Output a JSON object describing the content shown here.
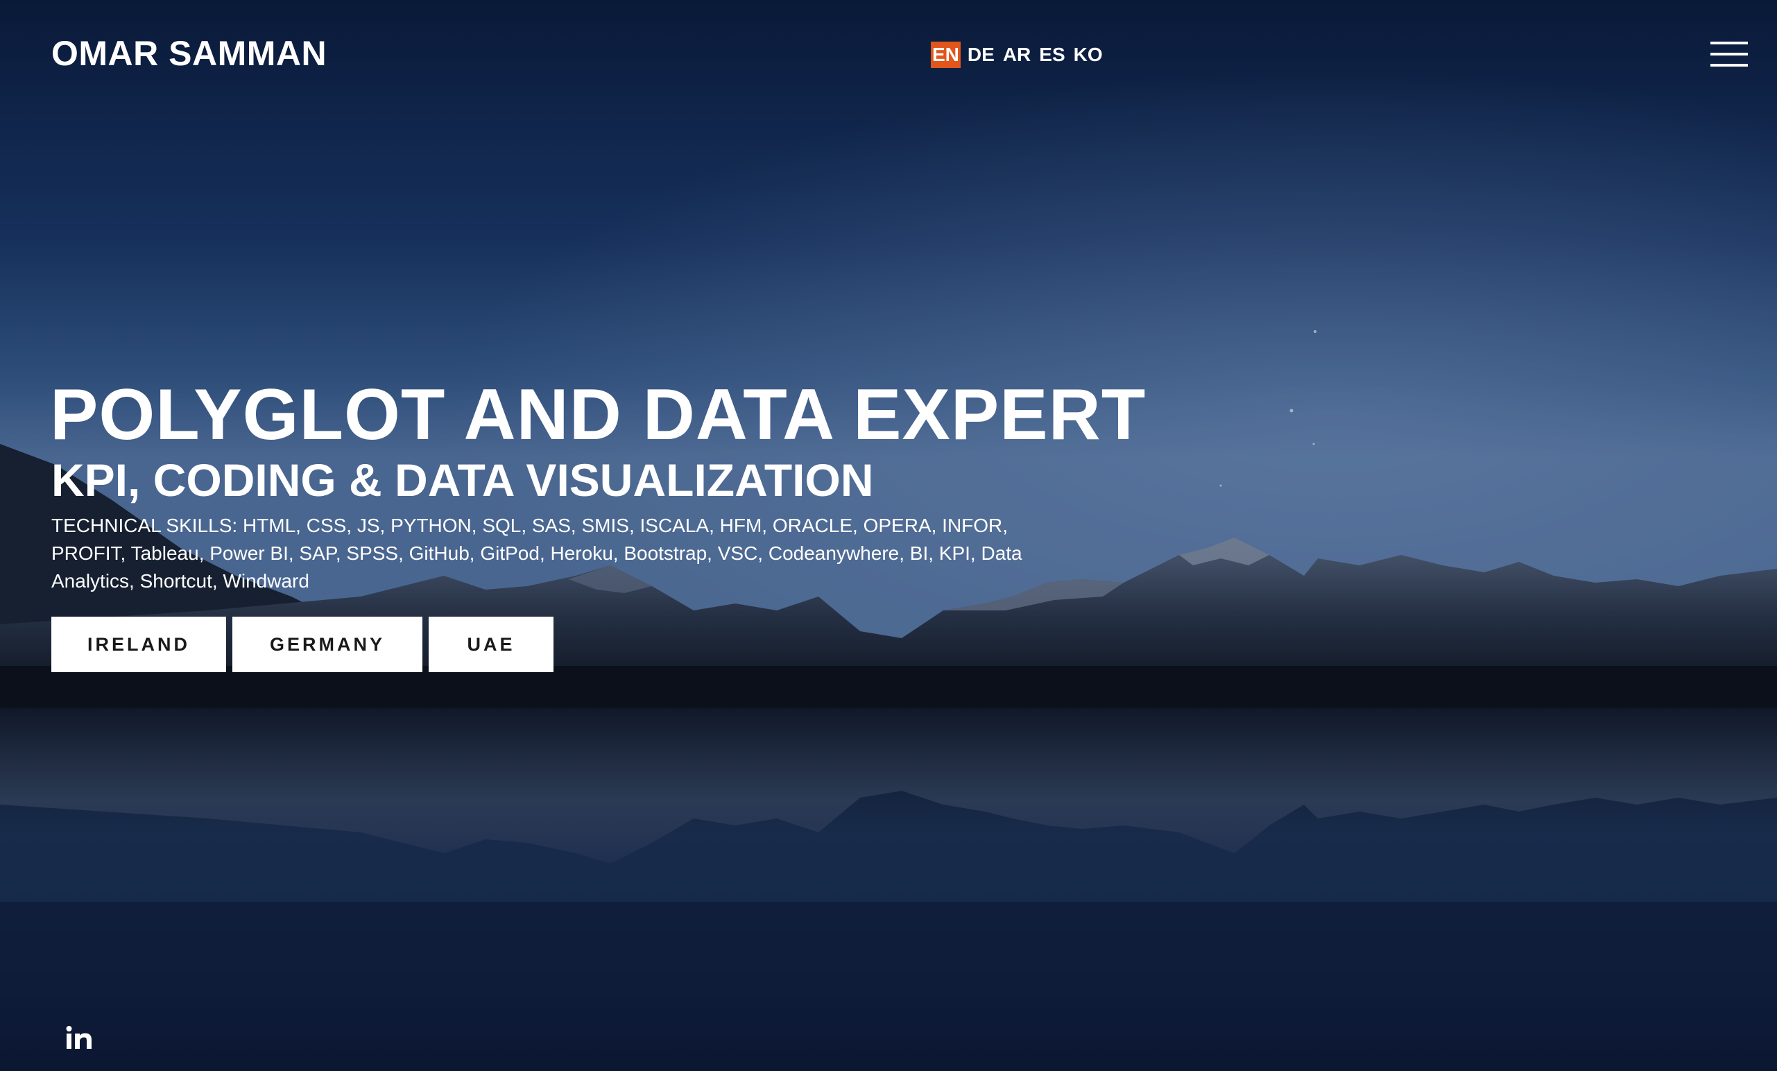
{
  "header": {
    "brand": "OMAR SAMMAN",
    "languages": [
      "EN",
      "DE",
      "AR",
      "ES",
      "KO"
    ],
    "active_language": "EN",
    "menu_icon": "hamburger-menu-icon"
  },
  "hero": {
    "title": "POLYGLOT AND DATA EXPERT",
    "subtitle": "KPI, CODING & DATA VISUALIZATION",
    "skills": "TECHNICAL SKILLS: HTML, CSS, JS, PYTHON, SQL, SAS, SMIS, ISCALA, HFM, ORACLE, OPERA, INFOR, PROFIT, Tableau, Power BI, SAP, SPSS, GitHub, GitPod, Heroku, Bootstrap, VSC, Codeanywhere, BI, KPI, Data Analytics, Shortcut, Windward",
    "buttons": [
      "IRELAND",
      "GERMANY",
      "UAE"
    ]
  },
  "social": {
    "linkedin_icon": "linkedin-icon"
  },
  "colors": {
    "accent": "#e0561c",
    "text": "#ffffff",
    "button_bg": "#ffffff",
    "button_text": "#1a1a1a"
  }
}
